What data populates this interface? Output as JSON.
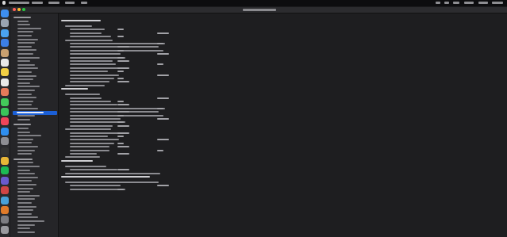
{
  "menubar": {
    "apple_icon": "apple-icon",
    "items": [
      {
        "label": ""
      },
      {
        "label": ""
      },
      {
        "label": ""
      },
      {
        "label": ""
      },
      {
        "label": ""
      }
    ],
    "status_items": [
      {
        "label": ""
      },
      {
        "label": ""
      },
      {
        "label": ""
      },
      {
        "label": ""
      },
      {
        "label": ""
      },
      {
        "label": ""
      }
    ]
  },
  "window": {
    "title": "",
    "colors": {
      "close": "#ff5f57",
      "minimize": "#febc2e",
      "zoom": "#28c840",
      "selection": "#1b5fd6"
    }
  },
  "dock": {
    "apps": [
      {
        "icon": "finder-icon",
        "color": "#3d8ef0"
      },
      {
        "icon": "launchpad-icon",
        "color": "#9aa4b1"
      },
      {
        "icon": "safari-icon",
        "color": "#4aa3f0"
      },
      {
        "icon": "mail-icon",
        "color": "#3c7fe6"
      },
      {
        "icon": "contacts-icon",
        "color": "#c9a070"
      },
      {
        "icon": "calendar-icon",
        "color": "#e8e8e8"
      },
      {
        "icon": "notes-icon",
        "color": "#f2cf44"
      },
      {
        "icon": "reminders-icon",
        "color": "#e9e9e9"
      },
      {
        "icon": "photos-icon",
        "color": "#e57a5a"
      },
      {
        "icon": "messages-icon",
        "color": "#43c95a"
      },
      {
        "icon": "facetime-icon",
        "color": "#3bc35a"
      },
      {
        "icon": "music-icon",
        "color": "#f0455a"
      },
      {
        "icon": "appstore-icon",
        "color": "#2f8ff0"
      },
      {
        "icon": "settings-icon",
        "color": "#8e8e93"
      },
      {
        "icon": "terminal-icon",
        "color": "#333333"
      },
      {
        "icon": "chrome-icon",
        "color": "#e8b637"
      },
      {
        "icon": "spotify-icon",
        "color": "#1db954"
      },
      {
        "icon": "app-icon",
        "color": "#6a5acd"
      },
      {
        "icon": "app-icon",
        "color": "#d04545"
      },
      {
        "icon": "app-icon",
        "color": "#48a0d8"
      },
      {
        "icon": "app-icon",
        "color": "#e07b2a"
      },
      {
        "icon": "app-icon",
        "color": "#7d7d82"
      },
      {
        "icon": "trash-icon",
        "color": "#9a9a9f"
      }
    ]
  },
  "sidebar": {
    "rows": [
      {
        "label": "",
        "group": true
      },
      {
        "label": ""
      },
      {
        "label": ""
      },
      {
        "label": ""
      },
      {
        "label": ""
      },
      {
        "label": ""
      },
      {
        "label": ""
      },
      {
        "label": ""
      },
      {
        "label": ""
      },
      {
        "label": ""
      },
      {
        "label": ""
      },
      {
        "label": ""
      },
      {
        "label": ""
      },
      {
        "label": ""
      },
      {
        "label": ""
      },
      {
        "label": ""
      },
      {
        "label": ""
      },
      {
        "label": ""
      },
      {
        "label": ""
      },
      {
        "label": ""
      },
      {
        "label": ""
      },
      {
        "label": ""
      },
      {
        "label": ""
      },
      {
        "label": ""
      },
      {
        "label": ""
      },
      {
        "label": ""
      },
      {
        "label": "",
        "selected": true
      },
      {
        "label": ""
      },
      {
        "label": ""
      },
      {
        "label": "",
        "group": true
      },
      {
        "label": ""
      },
      {
        "label": ""
      },
      {
        "label": ""
      },
      {
        "label": ""
      },
      {
        "label": ""
      },
      {
        "label": ""
      },
      {
        "label": ""
      },
      {
        "label": ""
      },
      {
        "label": "",
        "group": true
      },
      {
        "label": ""
      },
      {
        "label": ""
      },
      {
        "label": ""
      },
      {
        "label": ""
      },
      {
        "label": ""
      },
      {
        "label": ""
      },
      {
        "label": ""
      },
      {
        "label": ""
      },
      {
        "label": ""
      },
      {
        "label": ""
      },
      {
        "label": ""
      },
      {
        "label": ""
      },
      {
        "label": ""
      },
      {
        "label": ""
      },
      {
        "label": ""
      },
      {
        "label": ""
      },
      {
        "label": ""
      },
      {
        "label": ""
      },
      {
        "label": ""
      },
      {
        "label": ""
      }
    ]
  },
  "content": {
    "lines": [
      {
        "key": "",
        "head": true
      },
      {
        "key": ""
      },
      {
        "key": "",
        "value": ""
      },
      {
        "key": "",
        "value": ""
      },
      {
        "key": "",
        "value": ""
      },
      {
        "key": ""
      },
      {
        "key": "",
        "value": ""
      },
      {
        "key": "",
        "value": ""
      },
      {
        "key": "",
        "value": ""
      },
      {
        "key": "",
        "value": ""
      },
      {
        "key": "",
        "value": ""
      },
      {
        "key": "",
        "value": ""
      },
      {
        "key": "",
        "value": ""
      },
      {
        "key": "",
        "value": ""
      },
      {
        "key": "",
        "value": ""
      },
      {
        "key": "",
        "value": ""
      },
      {
        "key": "",
        "value": ""
      },
      {
        "key": "",
        "value": ""
      },
      {
        "key": ""
      },
      {
        "key": "",
        "head": true
      },
      {
        "key": ""
      },
      {
        "key": "",
        "value": ""
      },
      {
        "key": "",
        "value": ""
      },
      {
        "key": "",
        "value": ""
      },
      {
        "key": "",
        "value": ""
      },
      {
        "key": "",
        "value": ""
      },
      {
        "key": "",
        "value": ""
      },
      {
        "key": "",
        "value": ""
      },
      {
        "key": "",
        "value": ""
      },
      {
        "key": "",
        "value": ""
      },
      {
        "key": ""
      },
      {
        "key": "",
        "value": ""
      },
      {
        "key": "",
        "value": ""
      },
      {
        "key": "",
        "value": ""
      },
      {
        "key": "",
        "value": ""
      },
      {
        "key": "",
        "value": ""
      },
      {
        "key": "",
        "value": ""
      },
      {
        "key": "",
        "value": ""
      },
      {
        "key": ""
      },
      {
        "key": "",
        "head": true
      },
      {
        "key": ""
      },
      {
        "key": "",
        "value": ""
      },
      {
        "key": ""
      },
      {
        "key": "",
        "head": true
      },
      {
        "key": ""
      },
      {
        "key": "",
        "value": ""
      },
      {
        "key": "",
        "value": ""
      }
    ]
  }
}
